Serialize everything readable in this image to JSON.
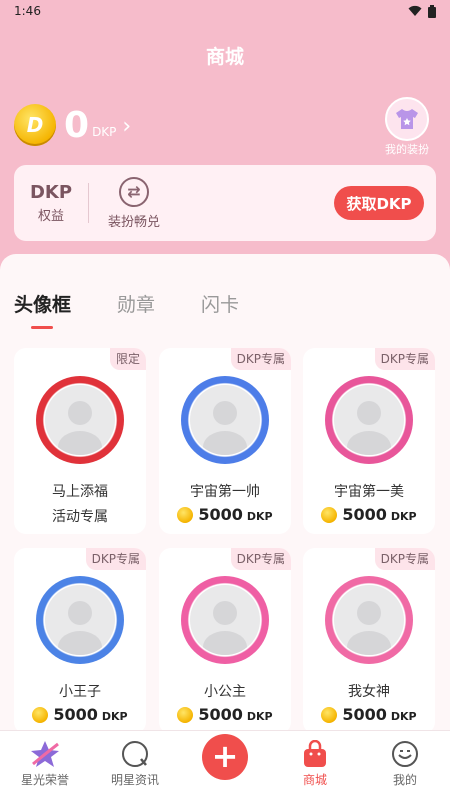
{
  "status_bar": {
    "time": "1:46"
  },
  "header": {
    "title": "商城"
  },
  "balance": {
    "value": "0",
    "unit": "DKP",
    "coin_symbol": "D"
  },
  "my_outfit": {
    "label": "我的装扮"
  },
  "benefits": {
    "dkp_label": "DKP",
    "benefit_label": "权益",
    "exchange_label": "装扮畅兑",
    "get_button": "获取DKP"
  },
  "tabs": [
    {
      "label": "头像框",
      "active": true
    },
    {
      "label": "勋章",
      "active": false
    },
    {
      "label": "闪卡",
      "active": false
    }
  ],
  "items": [
    {
      "tag": "限定",
      "name": "马上添福",
      "subtitle": "活动专属",
      "frame_color": "#e0323a",
      "frame_text": "马上添福"
    },
    {
      "tag": "DKP专属",
      "name": "宇宙第一帅",
      "price": "5000",
      "unit": "DKP",
      "frame_color": "#4d7de8",
      "frame_text": "宇宙第一帅"
    },
    {
      "tag": "DKP专属",
      "name": "宇宙第一美",
      "price": "5000",
      "unit": "DKP",
      "frame_color": "#e8569a",
      "frame_text": "宇宙第一美"
    },
    {
      "tag": "DKP专属",
      "name": "小王子",
      "price": "5000",
      "unit": "DKP",
      "frame_color": "#4c83e6",
      "frame_text": "小王子"
    },
    {
      "tag": "DKP专属",
      "name": "小公主",
      "price": "5000",
      "unit": "DKP",
      "frame_color": "#ef5fa4",
      "frame_text": "小公主"
    },
    {
      "tag": "DKP专属",
      "name": "我女神",
      "price": "5000",
      "unit": "DKP",
      "frame_color": "#f06aa5",
      "frame_text": "我女神"
    }
  ],
  "nav": [
    {
      "label": "星光荣誉",
      "icon": "star-icon",
      "active": false
    },
    {
      "label": "明星资讯",
      "icon": "news-icon",
      "active": false
    },
    {
      "label": "",
      "icon": "plus-icon",
      "active": false
    },
    {
      "label": "商城",
      "icon": "shop-bag-icon",
      "active": true
    },
    {
      "label": "我的",
      "icon": "profile-icon",
      "active": false
    }
  ],
  "colors": {
    "accent": "#f04e4c",
    "background": "#f6bccb",
    "panel": "#fef7f8"
  }
}
